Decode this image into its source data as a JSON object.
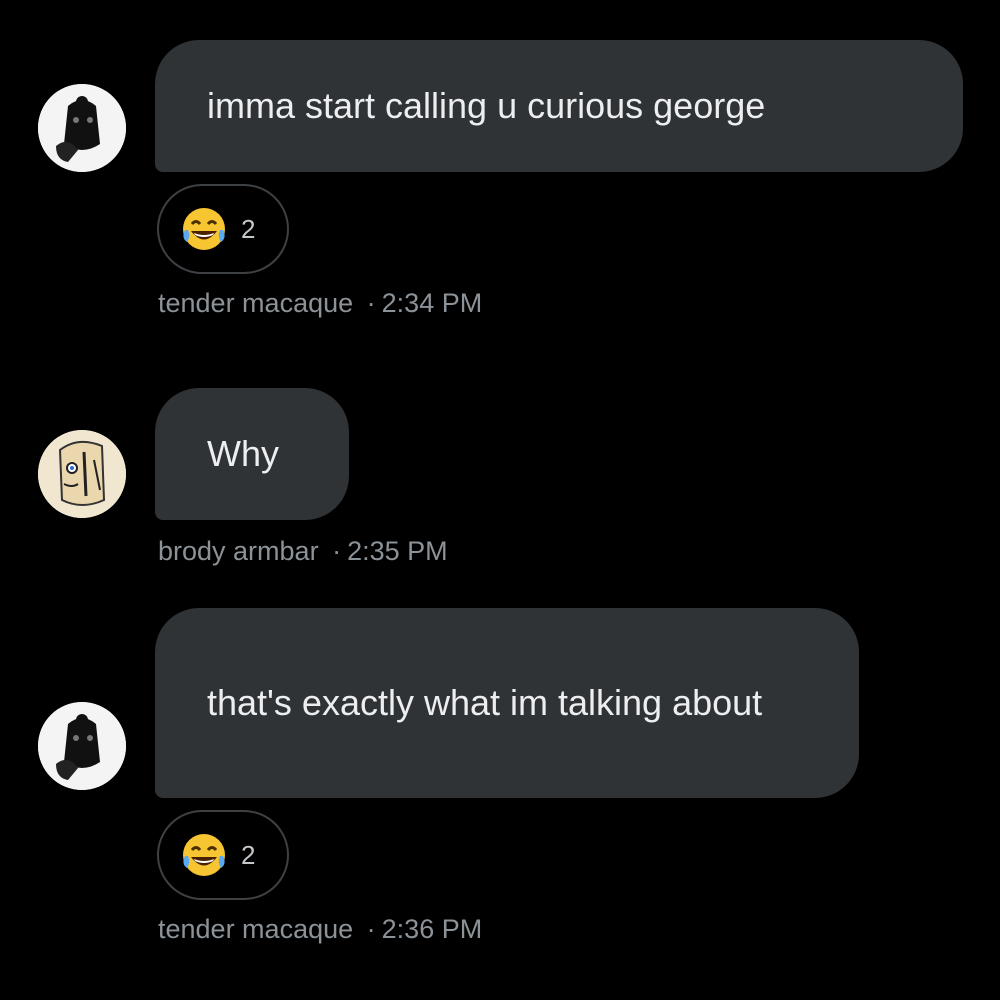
{
  "messages": [
    {
      "avatar": "monkey-sketch-avatar-icon",
      "text": "imma start calling u curious george",
      "reaction": {
        "emoji": "face-with-tears-of-joy-icon",
        "count": "2"
      },
      "sender": "tender macaque",
      "separator": "·",
      "time": "2:34 PM"
    },
    {
      "avatar": "cartoon-face-avatar-icon",
      "text": "Why",
      "sender": "brody armbar",
      "separator": "·",
      "time": "2:35 PM"
    },
    {
      "avatar": "monkey-sketch-avatar-icon",
      "text": "that's exactly what im talking about",
      "reaction": {
        "emoji": "face-with-tears-of-joy-icon",
        "count": "2"
      },
      "sender": "tender macaque",
      "separator": "·",
      "time": "2:36 PM"
    }
  ],
  "colors": {
    "background": "#000000",
    "bubble": "#2f3336",
    "meta_text": "#8b9298",
    "message_text": "#eceef0"
  }
}
